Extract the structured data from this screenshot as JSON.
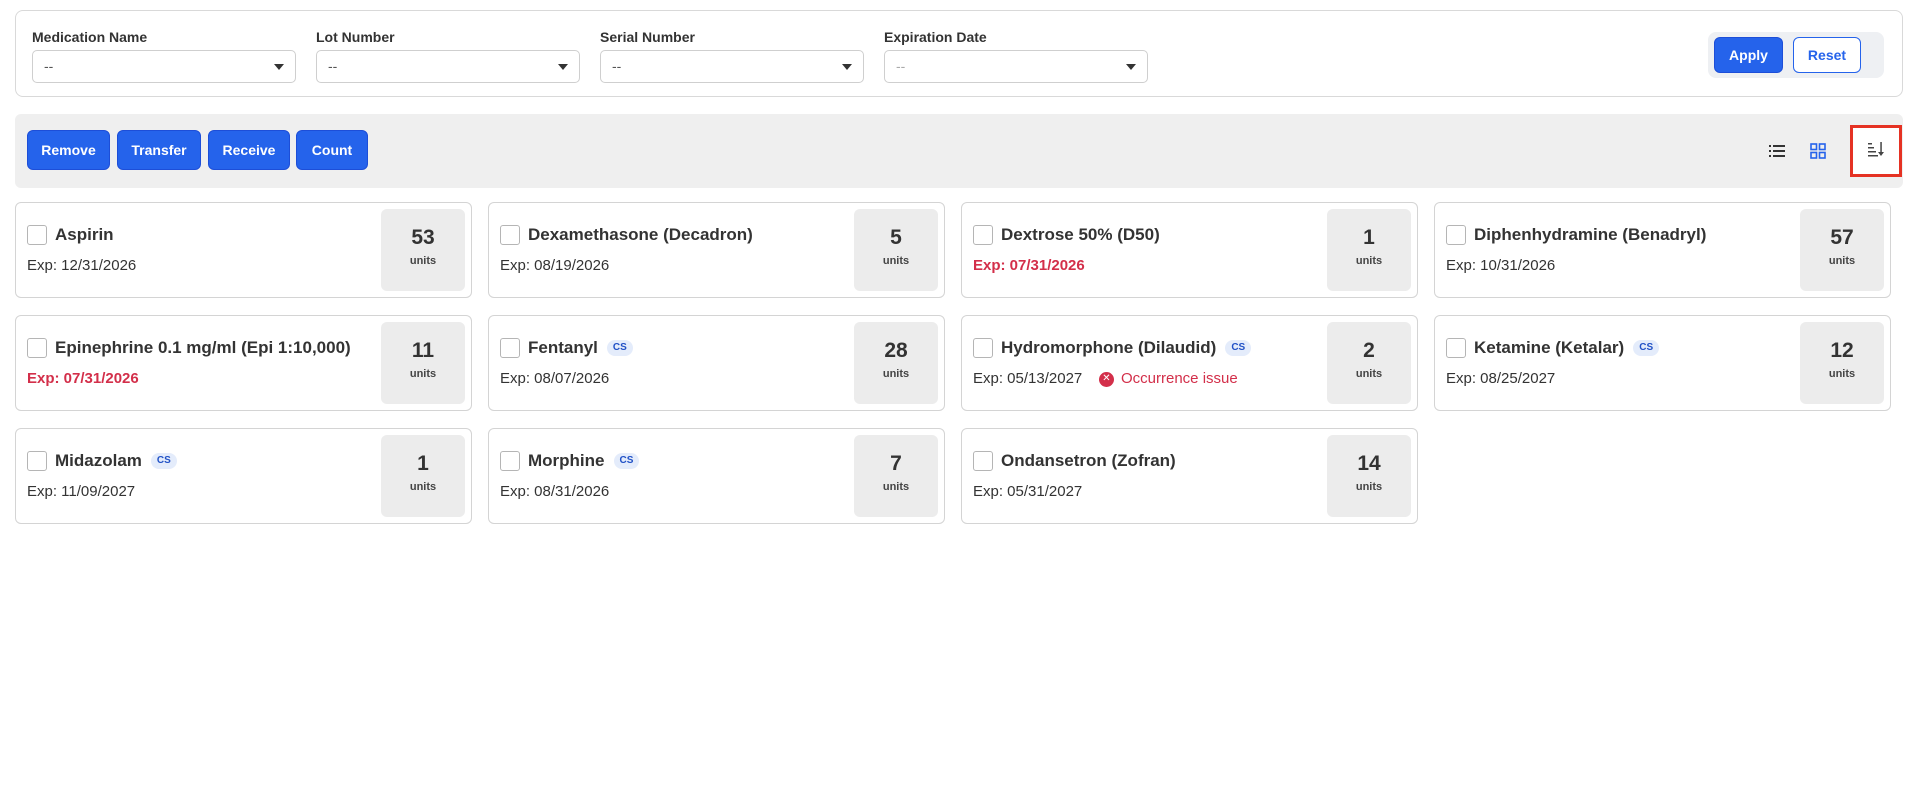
{
  "filters": {
    "medication_name": {
      "label": "Medication Name",
      "value": "--"
    },
    "lot_number": {
      "label": "Lot Number",
      "value": "--"
    },
    "serial_number": {
      "label": "Serial Number",
      "value": "--"
    },
    "expiration_date": {
      "label": "Expiration Date",
      "value": "--"
    },
    "apply_label": "Apply",
    "reset_label": "Reset"
  },
  "toolbar": {
    "remove_label": "Remove",
    "transfer_label": "Transfer",
    "receive_label": "Receive",
    "count_label": "Count",
    "view_icons": [
      "list-view-icon",
      "grid-view-icon",
      "sort-icon"
    ]
  },
  "colors": {
    "primary": "#2563eb",
    "expired": "#d32f4a",
    "highlight": "#e53223",
    "badge_bg": "#e4ecfb"
  },
  "unit_label": "units",
  "cs_label": "CS",
  "medications": [
    {
      "name": "Aspirin",
      "cs": false,
      "exp": "Exp: 12/31/2026",
      "expired": false,
      "count": "53"
    },
    {
      "name": "Dexamethasone (Decadron)",
      "cs": false,
      "exp": "Exp: 08/19/2026",
      "expired": false,
      "count": "5"
    },
    {
      "name": "Dextrose 50% (D50)",
      "cs": false,
      "exp": "Exp: 07/31/2026",
      "expired": true,
      "count": "1"
    },
    {
      "name": "Diphenhydramine (Benadryl)",
      "cs": false,
      "exp": "Exp: 10/31/2026",
      "expired": false,
      "count": "57"
    },
    {
      "name": "Epinephrine 0.1 mg/ml (Epi 1:10,000)",
      "cs": false,
      "exp": "Exp: 07/31/2026",
      "expired": true,
      "count": "11"
    },
    {
      "name": "Fentanyl",
      "cs": true,
      "exp": "Exp: 08/07/2026",
      "expired": false,
      "count": "28"
    },
    {
      "name": "Hydromorphone (Dilaudid)",
      "cs": true,
      "exp": "Exp: 05/13/2027",
      "expired": false,
      "count": "2",
      "issue": "Occurrence issue"
    },
    {
      "name": "Ketamine (Ketalar)",
      "cs": true,
      "exp": "Exp: 08/25/2027",
      "expired": false,
      "count": "12"
    },
    {
      "name": "Midazolam",
      "cs": true,
      "exp": "Exp: 11/09/2027",
      "expired": false,
      "count": "1"
    },
    {
      "name": "Morphine",
      "cs": true,
      "exp": "Exp: 08/31/2026",
      "expired": false,
      "count": "7"
    },
    {
      "name": "Ondansetron (Zofran)",
      "cs": false,
      "exp": "Exp: 05/31/2027",
      "expired": false,
      "count": "14"
    }
  ]
}
